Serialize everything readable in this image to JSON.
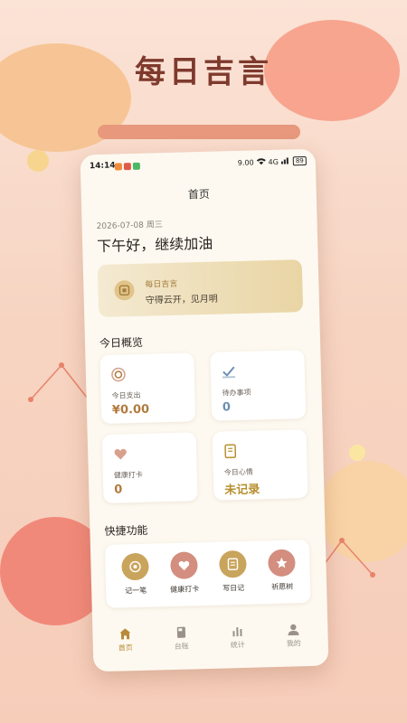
{
  "hero": {
    "title": "每日吉言"
  },
  "status_bar": {
    "time": "14:14",
    "network": "9.00",
    "signal": "4G",
    "battery": "89"
  },
  "nav": {
    "title": "首页"
  },
  "header": {
    "date": "2026-07-08 周三",
    "greeting": "下午好，继续加油"
  },
  "quote_card": {
    "title": "每日吉言",
    "text": "守得云开，见月明",
    "icon": "seal-icon"
  },
  "overview": {
    "section_title": "今日概览",
    "cards": [
      {
        "label": "今日支出",
        "value": "¥0.00",
        "icon": "circle-target-icon",
        "color": "#b07a3c"
      },
      {
        "label": "待办事项",
        "value": "0",
        "icon": "checkmark-icon",
        "color": "#6c8fb0"
      },
      {
        "label": "健康打卡",
        "value": "0",
        "icon": "heart-icon",
        "color": "#b07a3c"
      },
      {
        "label": "今日心情",
        "value": "未记录",
        "icon": "notebook-icon",
        "color": "#b8902e"
      }
    ]
  },
  "quick_actions": {
    "section_title": "快捷功能",
    "items": [
      {
        "label": "记一笔",
        "icon": "record-icon",
        "color": "#c9a45c"
      },
      {
        "label": "健康打卡",
        "icon": "heart-icon",
        "color": "#d38e80"
      },
      {
        "label": "写日记",
        "icon": "notebook-icon",
        "color": "#c9a45c"
      },
      {
        "label": "祈愿树",
        "icon": "star-icon",
        "color": "#d38e80"
      }
    ]
  },
  "tab_bar": {
    "tabs": [
      {
        "label": "首页",
        "icon": "home-icon",
        "active": true
      },
      {
        "label": "台账",
        "icon": "ledger-icon",
        "active": false
      },
      {
        "label": "统计",
        "icon": "stats-icon",
        "active": false
      },
      {
        "label": "我的",
        "icon": "profile-icon",
        "active": false
      }
    ],
    "accent": "#b98a3a"
  }
}
